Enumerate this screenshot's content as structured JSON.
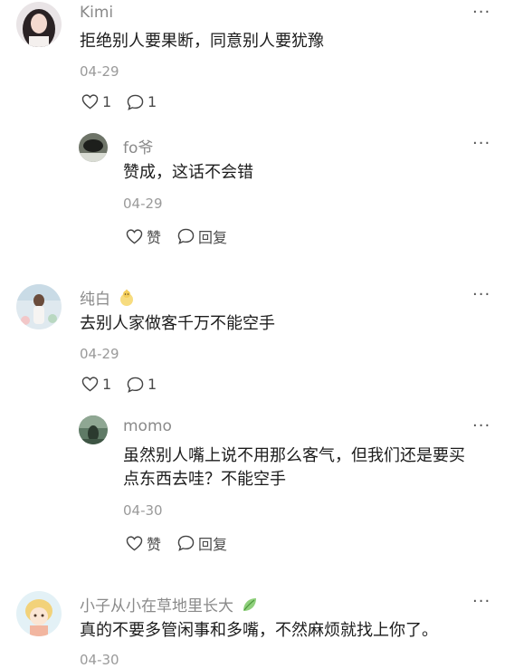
{
  "comments": [
    {
      "name": "Kimi",
      "text": "拒绝别人要果断，同意别人要犹豫",
      "date": "04-29",
      "like_count": "1",
      "reply_count": "1",
      "reply": {
        "name": "fo爷",
        "text_lines": [
          "赞成，这话不会错"
        ],
        "date": "04-29",
        "like_label": "赞",
        "reply_label": "回复"
      }
    },
    {
      "name": "纯白",
      "text": "去别人家做客千万不能空手",
      "date": "04-29",
      "like_count": "1",
      "reply_count": "1",
      "reply": {
        "name": "momo",
        "text_lines": [
          "虽然别人嘴上说不用那么客气，但我们还是要买",
          "点东西去哇？不能空手"
        ],
        "date": "04-30",
        "like_label": "赞",
        "reply_label": "回复"
      }
    },
    {
      "name": "小子从小在草地里长大",
      "text": "真的不要多管闲事和多嘴，不然麻烦就找上你了。",
      "date": "04-30"
    }
  ],
  "more_label": "···",
  "icons": {
    "like": "heart-outline-icon",
    "comment": "speech-bubble-icon",
    "badge_baby": "baby-chick-badge-icon",
    "badge_leaf": "leaf-badge-icon"
  }
}
